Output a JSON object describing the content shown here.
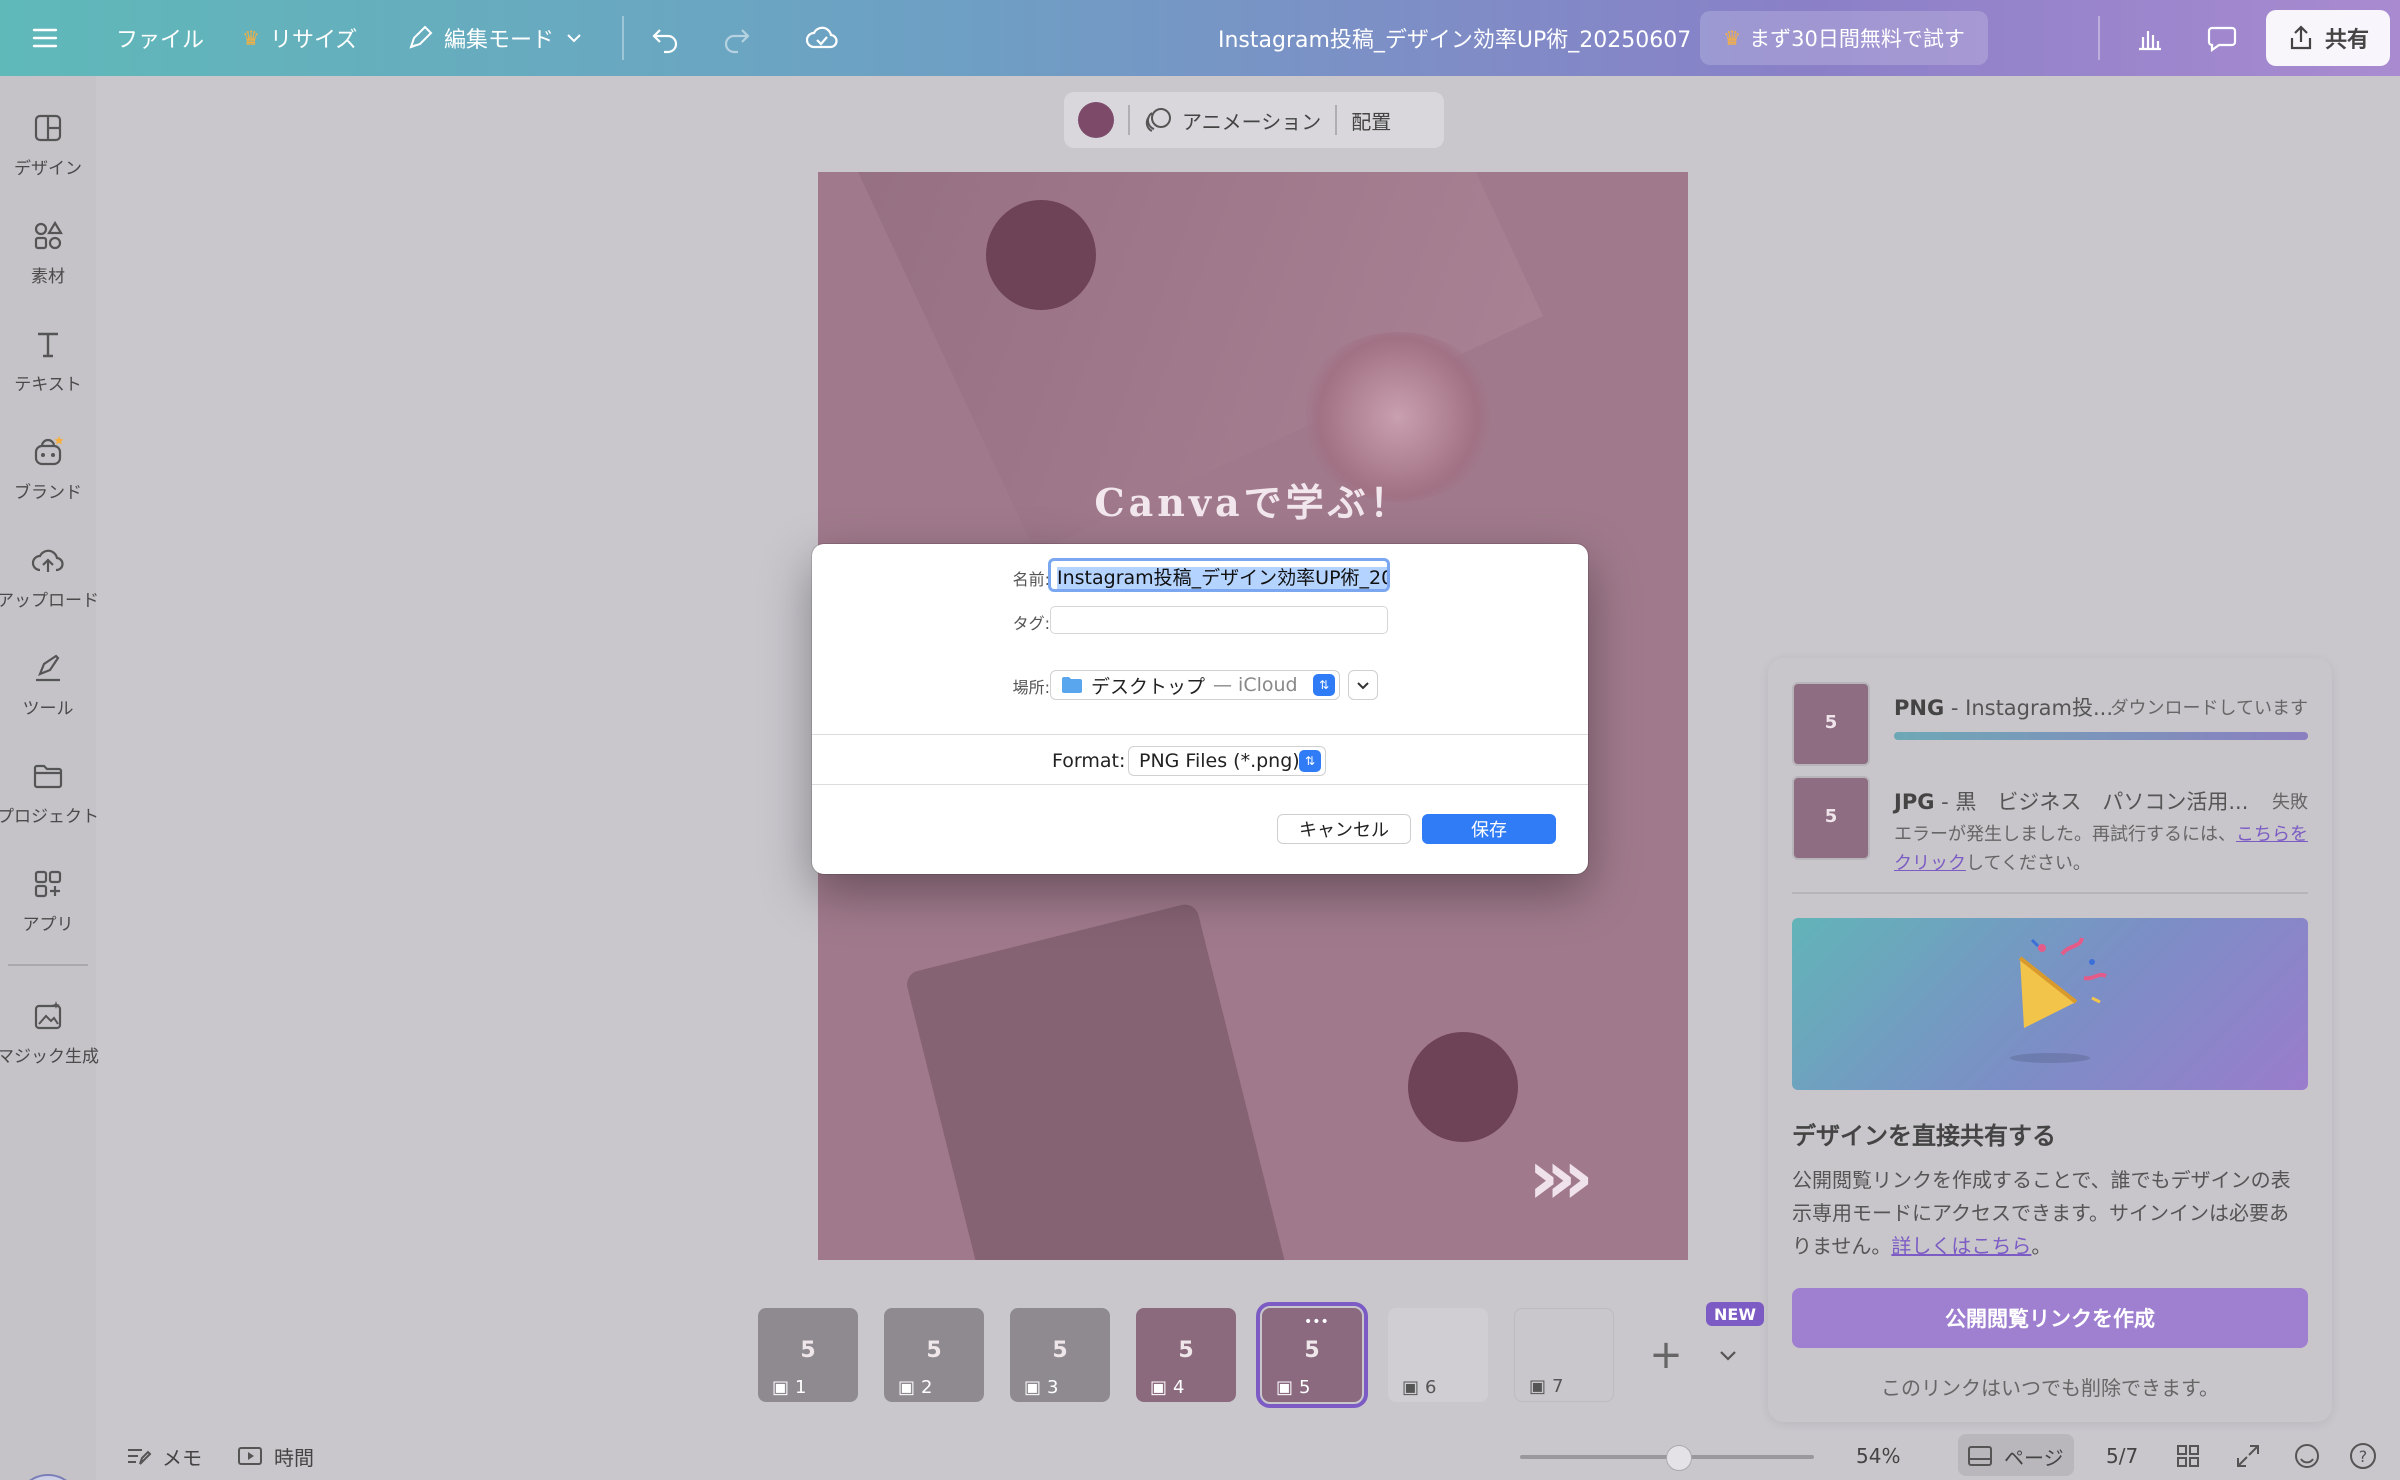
{
  "topbar": {
    "file": "ファイル",
    "resize": "リサイズ",
    "edit_mode": "編集モード",
    "document_title": "Instagram投稿_デザイン効率UP術_20250607",
    "trial": "まず30日間無料で試す",
    "share": "共有"
  },
  "sidebar": {
    "items": [
      {
        "label": "デザイン",
        "icon": "layout-icon"
      },
      {
        "label": "素材",
        "icon": "shapes-icon"
      },
      {
        "label": "テキスト",
        "icon": "text-icon"
      },
      {
        "label": "ブランド",
        "icon": "brand-icon"
      },
      {
        "label": "アップロード",
        "icon": "cloud-upload-icon"
      },
      {
        "label": "ツール",
        "icon": "pen-tool-icon"
      },
      {
        "label": "プロジェクト",
        "icon": "folder-icon"
      },
      {
        "label": "アプリ",
        "icon": "apps-icon"
      },
      {
        "label": "マジック生成",
        "icon": "magic-image-icon"
      }
    ]
  },
  "element_toolbar": {
    "animation": "アニメーション",
    "arrange": "配置",
    "color": "#7d4a6a"
  },
  "artboard": {
    "headline": "Canvaで学ぶ！",
    "arrows": "›››"
  },
  "pages": {
    "items": [
      {
        "num": "1"
      },
      {
        "num": "2"
      },
      {
        "num": "3"
      },
      {
        "num": "4"
      },
      {
        "num": "5"
      },
      {
        "num": "6"
      },
      {
        "num": "7"
      }
    ],
    "thumb_digit": "5",
    "active": "5",
    "more": "•••",
    "new_badge": "NEW"
  },
  "bottombar": {
    "notes": "メモ",
    "timer": "時間",
    "zoom": "54%",
    "zoom_fraction": 0.54,
    "page_view": "ページ",
    "page_count": "5/7",
    "help": "?"
  },
  "share_panel": {
    "downloads": [
      {
        "format": "PNG",
        "name": " - Instagram投...",
        "status": "ダウンロードしています",
        "progress": 1.0
      },
      {
        "format": "JPG",
        "name": " - 黒　ビジネス　パソコン活用...",
        "status": "失敗",
        "error_before": "エラーが発生しました。再試行するには、",
        "error_link": "こちらをクリック",
        "error_after": "してください。"
      }
    ],
    "heading": "デザインを直接共有する",
    "description": "公開閲覧リンクを作成することで、誰でもデザインの表示専用モードにアクセスできます。サインインは必要ありません。",
    "learn_more": "詳しくはこちら",
    "learn_more_after": "。",
    "create_link": "公開閲覧リンクを作成",
    "note": "このリンクはいつでも削除できます。"
  },
  "save_dialog": {
    "name_label": "名前:",
    "name_value": "Instagram投稿_デザイン効率UP術_20",
    "tag_label": "タグ:",
    "tag_value": "",
    "location_label": "場所:",
    "location_value": "デスクトップ",
    "location_suffix": "— iCloud",
    "format_label": "Format:",
    "format_value": "PNG Files (*.png)",
    "cancel": "キャンセル",
    "save": "保存"
  }
}
